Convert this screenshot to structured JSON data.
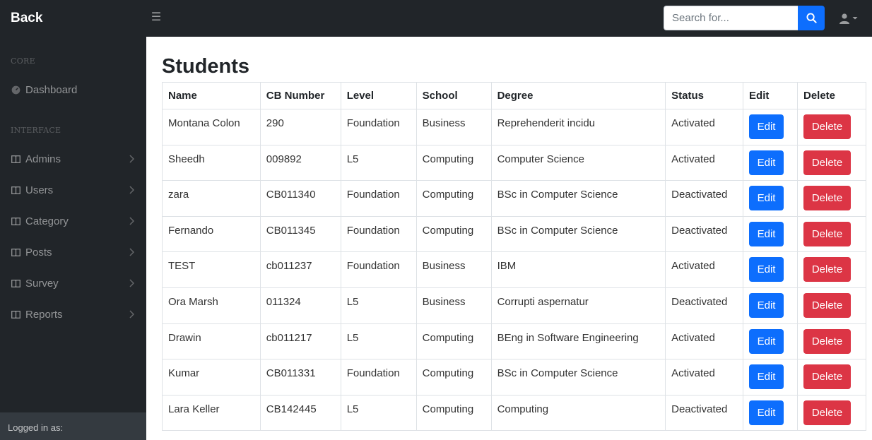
{
  "brand": "Back",
  "search": {
    "placeholder": "Search for..."
  },
  "sidebar": {
    "core_heading": "CORE",
    "dashboard": "Dashboard",
    "interface_heading": "INTERFACE",
    "items": [
      {
        "label": "Admins"
      },
      {
        "label": "Users"
      },
      {
        "label": "Category"
      },
      {
        "label": "Posts"
      },
      {
        "label": "Survey"
      },
      {
        "label": "Reports"
      }
    ],
    "footer": "Logged in as:"
  },
  "page_title": "Students",
  "table": {
    "headers": [
      "Name",
      "CB Number",
      "Level",
      "School",
      "Degree",
      "Status",
      "Edit",
      "Delete"
    ],
    "edit_label": "Edit",
    "delete_label": "Delete",
    "rows": [
      {
        "name": "Montana Colon",
        "cb": "290",
        "level": "Foundation",
        "school": "Business",
        "degree": "Reprehenderit incidu",
        "status": "Activated"
      },
      {
        "name": "Sheedh",
        "cb": "009892",
        "level": "L5",
        "school": "Computing",
        "degree": "Computer Science",
        "status": "Activated"
      },
      {
        "name": "zara",
        "cb": "CB011340",
        "level": "Foundation",
        "school": "Computing",
        "degree": "BSc in Computer Science",
        "status": "Deactivated"
      },
      {
        "name": "Fernando",
        "cb": "CB011345",
        "level": "Foundation",
        "school": "Computing",
        "degree": "BSc in Computer Science",
        "status": "Deactivated"
      },
      {
        "name": "TEST",
        "cb": "cb011237",
        "level": "Foundation",
        "school": "Business",
        "degree": "IBM",
        "status": "Activated"
      },
      {
        "name": "Ora Marsh",
        "cb": "011324",
        "level": "L5",
        "school": "Business",
        "degree": "Corrupti aspernatur",
        "status": "Deactivated"
      },
      {
        "name": "Drawin",
        "cb": "cb011217",
        "level": "L5",
        "school": "Computing",
        "degree": "BEng in Software Engineering",
        "status": "Activated"
      },
      {
        "name": "Kumar",
        "cb": "CB011331",
        "level": "Foundation",
        "school": "Computing",
        "degree": "BSc in Computer Science",
        "status": "Activated"
      },
      {
        "name": "Lara Keller",
        "cb": "CB142445",
        "level": "L5",
        "school": "Computing",
        "degree": "Computing",
        "status": "Deactivated"
      }
    ]
  },
  "icons": {
    "menu": "bars-icon",
    "search": "search-icon",
    "user": "user-icon",
    "dashboard": "tachometer-icon",
    "columns": "columns-icon",
    "chevron": "chevron-right-icon"
  },
  "colors": {
    "nav_bg": "#212529",
    "primary": "#0d6efd",
    "danger": "#dc3545",
    "footer_bg": "#343a40"
  }
}
